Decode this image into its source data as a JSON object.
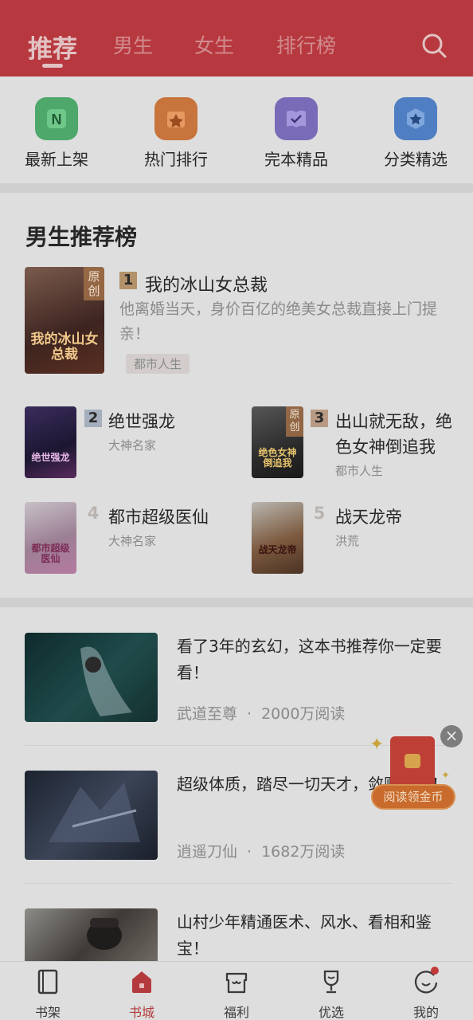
{
  "header": {
    "tabs": [
      {
        "label": "推荐",
        "active": true
      },
      {
        "label": "男生",
        "active": false
      },
      {
        "label": "女生",
        "active": false
      },
      {
        "label": "排行榜",
        "active": false
      }
    ],
    "search_icon": "search-icon",
    "accent_color": "#b7393f"
  },
  "quick_entries": [
    {
      "label": "最新上架",
      "icon": "new-shelf-icon",
      "color": "#4ea86b"
    },
    {
      "label": "热门排行",
      "icon": "hot-rank-icon",
      "color": "#c8743d"
    },
    {
      "label": "完本精品",
      "icon": "complete-book-icon",
      "color": "#7a6bb8"
    },
    {
      "label": "分类精选",
      "icon": "category-star-icon",
      "color": "#4f7fc2"
    }
  ],
  "ranking": {
    "title": "男生推荐榜",
    "top": {
      "rank": "1",
      "title": "我的冰山女总裁",
      "desc": "他离婚当天，身价百亿的绝美女总裁直接上门提亲！",
      "genre": "都市人生",
      "cover_tag": "原创",
      "cover_text": "我的冰山女总裁"
    },
    "items": [
      {
        "rank": "2",
        "title": "绝世强龙",
        "genre": "大神名家",
        "cover_text": "绝世强龙"
      },
      {
        "rank": "3",
        "title": "出山就无敌，绝色女神倒追我",
        "genre": "都市人生",
        "cover_tag": "原创",
        "cover_text": "绝色女神倒追我"
      },
      {
        "rank": "4",
        "title": "都市超级医仙",
        "genre": "大神名家",
        "cover_text": "都市超级医仙"
      },
      {
        "rank": "5",
        "title": "战天龙帝",
        "genre": "洪荒",
        "cover_text": "战天龙帝"
      }
    ]
  },
  "feed": [
    {
      "title": "看了3年的玄幻，这本书推荐你一定要看！",
      "book": "武道至尊",
      "reads": "2000万阅读"
    },
    {
      "title": "超级体质，踏尽一切天才，敛财无数！",
      "book": "逍遥刀仙",
      "reads": "1682万阅读"
    },
    {
      "title": "山村少年精通医术、风水、看相和鉴宝！",
      "book": "",
      "reads": ""
    }
  ],
  "feed_separator": "·",
  "float_widget": {
    "label": "阅读领金币",
    "close": "×"
  },
  "nav": [
    {
      "label": "书架",
      "icon": "bookshelf-icon",
      "active": false
    },
    {
      "label": "书城",
      "icon": "bookstore-icon",
      "active": true
    },
    {
      "label": "福利",
      "icon": "welfare-icon",
      "active": false
    },
    {
      "label": "优选",
      "icon": "trophy-icon",
      "active": false
    },
    {
      "label": "我的",
      "icon": "profile-icon",
      "active": false
    }
  ]
}
